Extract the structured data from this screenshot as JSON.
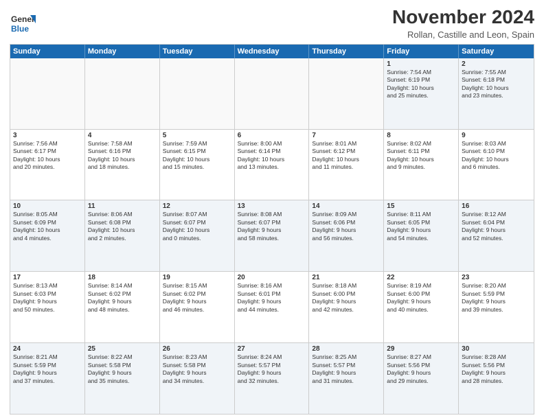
{
  "logo": {
    "line1": "General",
    "line2": "Blue"
  },
  "title": "November 2024",
  "subtitle": "Rollan, Castille and Leon, Spain",
  "header_days": [
    "Sunday",
    "Monday",
    "Tuesday",
    "Wednesday",
    "Thursday",
    "Friday",
    "Saturday"
  ],
  "weeks": [
    [
      {
        "day": "",
        "info": "",
        "empty": true
      },
      {
        "day": "",
        "info": "",
        "empty": true
      },
      {
        "day": "",
        "info": "",
        "empty": true
      },
      {
        "day": "",
        "info": "",
        "empty": true
      },
      {
        "day": "",
        "info": "",
        "empty": true
      },
      {
        "day": "1",
        "info": "Sunrise: 7:54 AM\nSunset: 6:19 PM\nDaylight: 10 hours\nand 25 minutes."
      },
      {
        "day": "2",
        "info": "Sunrise: 7:55 AM\nSunset: 6:18 PM\nDaylight: 10 hours\nand 23 minutes."
      }
    ],
    [
      {
        "day": "3",
        "info": "Sunrise: 7:56 AM\nSunset: 6:17 PM\nDaylight: 10 hours\nand 20 minutes."
      },
      {
        "day": "4",
        "info": "Sunrise: 7:58 AM\nSunset: 6:16 PM\nDaylight: 10 hours\nand 18 minutes."
      },
      {
        "day": "5",
        "info": "Sunrise: 7:59 AM\nSunset: 6:15 PM\nDaylight: 10 hours\nand 15 minutes."
      },
      {
        "day": "6",
        "info": "Sunrise: 8:00 AM\nSunset: 6:14 PM\nDaylight: 10 hours\nand 13 minutes."
      },
      {
        "day": "7",
        "info": "Sunrise: 8:01 AM\nSunset: 6:12 PM\nDaylight: 10 hours\nand 11 minutes."
      },
      {
        "day": "8",
        "info": "Sunrise: 8:02 AM\nSunset: 6:11 PM\nDaylight: 10 hours\nand 9 minutes."
      },
      {
        "day": "9",
        "info": "Sunrise: 8:03 AM\nSunset: 6:10 PM\nDaylight: 10 hours\nand 6 minutes."
      }
    ],
    [
      {
        "day": "10",
        "info": "Sunrise: 8:05 AM\nSunset: 6:09 PM\nDaylight: 10 hours\nand 4 minutes."
      },
      {
        "day": "11",
        "info": "Sunrise: 8:06 AM\nSunset: 6:08 PM\nDaylight: 10 hours\nand 2 minutes."
      },
      {
        "day": "12",
        "info": "Sunrise: 8:07 AM\nSunset: 6:07 PM\nDaylight: 10 hours\nand 0 minutes."
      },
      {
        "day": "13",
        "info": "Sunrise: 8:08 AM\nSunset: 6:07 PM\nDaylight: 9 hours\nand 58 minutes."
      },
      {
        "day": "14",
        "info": "Sunrise: 8:09 AM\nSunset: 6:06 PM\nDaylight: 9 hours\nand 56 minutes."
      },
      {
        "day": "15",
        "info": "Sunrise: 8:11 AM\nSunset: 6:05 PM\nDaylight: 9 hours\nand 54 minutes."
      },
      {
        "day": "16",
        "info": "Sunrise: 8:12 AM\nSunset: 6:04 PM\nDaylight: 9 hours\nand 52 minutes."
      }
    ],
    [
      {
        "day": "17",
        "info": "Sunrise: 8:13 AM\nSunset: 6:03 PM\nDaylight: 9 hours\nand 50 minutes."
      },
      {
        "day": "18",
        "info": "Sunrise: 8:14 AM\nSunset: 6:02 PM\nDaylight: 9 hours\nand 48 minutes."
      },
      {
        "day": "19",
        "info": "Sunrise: 8:15 AM\nSunset: 6:02 PM\nDaylight: 9 hours\nand 46 minutes."
      },
      {
        "day": "20",
        "info": "Sunrise: 8:16 AM\nSunset: 6:01 PM\nDaylight: 9 hours\nand 44 minutes."
      },
      {
        "day": "21",
        "info": "Sunrise: 8:18 AM\nSunset: 6:00 PM\nDaylight: 9 hours\nand 42 minutes."
      },
      {
        "day": "22",
        "info": "Sunrise: 8:19 AM\nSunset: 6:00 PM\nDaylight: 9 hours\nand 40 minutes."
      },
      {
        "day": "23",
        "info": "Sunrise: 8:20 AM\nSunset: 5:59 PM\nDaylight: 9 hours\nand 39 minutes."
      }
    ],
    [
      {
        "day": "24",
        "info": "Sunrise: 8:21 AM\nSunset: 5:59 PM\nDaylight: 9 hours\nand 37 minutes."
      },
      {
        "day": "25",
        "info": "Sunrise: 8:22 AM\nSunset: 5:58 PM\nDaylight: 9 hours\nand 35 minutes."
      },
      {
        "day": "26",
        "info": "Sunrise: 8:23 AM\nSunset: 5:58 PM\nDaylight: 9 hours\nand 34 minutes."
      },
      {
        "day": "27",
        "info": "Sunrise: 8:24 AM\nSunset: 5:57 PM\nDaylight: 9 hours\nand 32 minutes."
      },
      {
        "day": "28",
        "info": "Sunrise: 8:25 AM\nSunset: 5:57 PM\nDaylight: 9 hours\nand 31 minutes."
      },
      {
        "day": "29",
        "info": "Sunrise: 8:27 AM\nSunset: 5:56 PM\nDaylight: 9 hours\nand 29 minutes."
      },
      {
        "day": "30",
        "info": "Sunrise: 8:28 AM\nSunset: 5:56 PM\nDaylight: 9 hours\nand 28 minutes."
      }
    ]
  ]
}
